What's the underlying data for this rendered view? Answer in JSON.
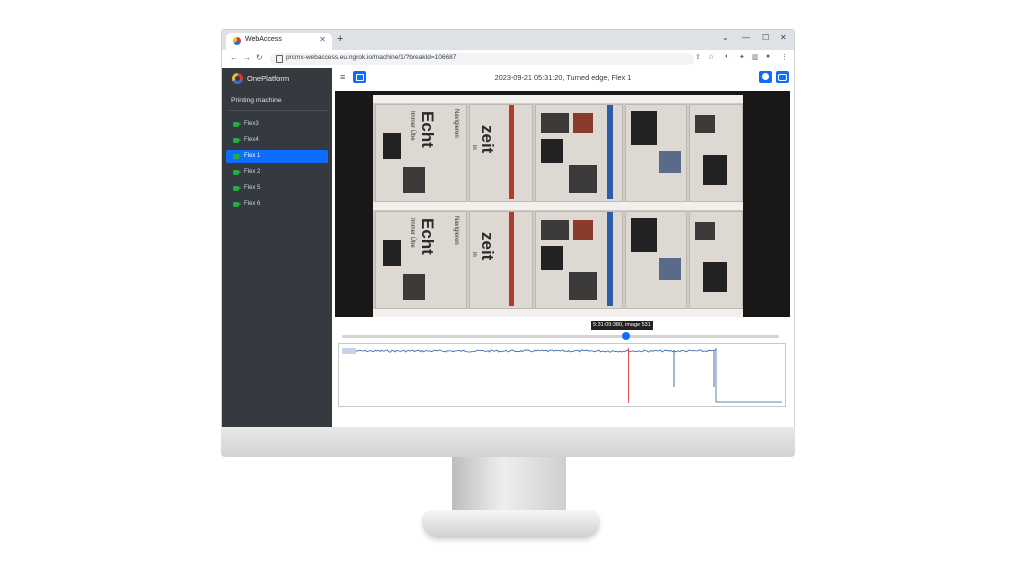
{
  "browser": {
    "tab_title": "WebAccess",
    "url": "prcmx-webaccess.eu.ngrok.io/machine/1/?breakId=106687"
  },
  "app": {
    "brand": "OnePlatform",
    "section_title": "Printing machine",
    "nav_items": [
      {
        "label": "Flex3",
        "active": false
      },
      {
        "label": "Flex4",
        "active": false
      },
      {
        "label": "Flex 1",
        "active": true
      },
      {
        "label": "Flex 2",
        "active": false
      },
      {
        "label": "Flex 5",
        "active": false
      },
      {
        "label": "Flex 6",
        "active": false
      }
    ],
    "header_title": "2023-09-21 05:31:20, Turned edge, Flex 1",
    "timeline_tooltip": "5:31:09:380, image 531",
    "timeline_position": 0.65
  },
  "video_text": {
    "word_echt": "Echt",
    "word_zeit": "zeit",
    "word_navigieren": "Navigieren",
    "word_immer": "Immer Übe",
    "word_in": "in"
  },
  "colors": {
    "sidebar_bg": "#343a40",
    "accent": "#0d6efd",
    "camera_icon": "#28a745",
    "signal_line": "#2f5fa8",
    "marker_red": "#e04848"
  },
  "signal_plot": {
    "cursor_fraction": 0.6486
  }
}
